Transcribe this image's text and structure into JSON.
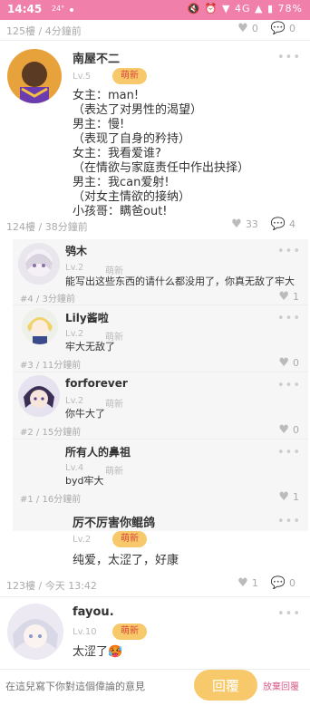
{
  "status_bar": {
    "time": "14:45",
    "tiny_text": "24°",
    "right_icons": "🔇 ⏰ ▼ 4G ▲ ▮ 78%"
  },
  "partial_top": {
    "meta": "125樓 / 4分鐘前",
    "likes": "0",
    "replies": "0"
  },
  "post_124": {
    "username": "南屋不二",
    "level": "Lv.5",
    "badge": "萌新",
    "lines": [
      "女主：man!",
      "（表达了对男性的渴望）",
      "男主：慢!",
      "（表现了自身的矜持）",
      "女主：我看爱谁?",
      "（在情欲与家庭责任中作出抉择）",
      "男主：我can爱射!",
      "（对女主情欲的接纳）",
      "小孩哥：瞒爸out!"
    ],
    "meta": "124樓 / 38分鐘前",
    "likes": "33",
    "replies": "4"
  },
  "sub_replies": [
    {
      "username": "鸮木",
      "level": "Lv.2",
      "badge": "萌新",
      "text": "能写出这些东西的请什么都没用了，你真无敌了牢大",
      "meta": "#4 / 3分鐘前",
      "likes": "1"
    },
    {
      "username": "Lily酱啦",
      "level": "Lv.2",
      "badge": "萌新",
      "text": "牢大无敌了",
      "meta": "#3 / 11分鐘前",
      "likes": "0"
    },
    {
      "username": "forforever",
      "level": "Lv.2",
      "badge": "萌新",
      "text": "你牛大了",
      "meta": "#2 / 15分鐘前",
      "likes": "0"
    },
    {
      "username": "所有人的鼻祖",
      "level": "Lv.4",
      "badge": "萌新",
      "text": "byd牢大",
      "meta": "#1 / 16分鐘前",
      "likes": "1"
    }
  ],
  "post_123": {
    "username": "厉不厉害你鲲鸽",
    "level": "Lv.2",
    "badge": "萌新",
    "text": "纯爱，太涩了，好康",
    "meta": "123樓 / 今天 13:42",
    "likes": "1",
    "replies": "0"
  },
  "post_122": {
    "username": "fayou.",
    "level": "Lv.10",
    "badge": "萌新",
    "text": "太涩了🥵"
  },
  "bottom_bar": {
    "placeholder": "在這兒寫下你對這個偉論的意見",
    "reply_label": "回覆",
    "discard_label": "放棄回覆"
  }
}
